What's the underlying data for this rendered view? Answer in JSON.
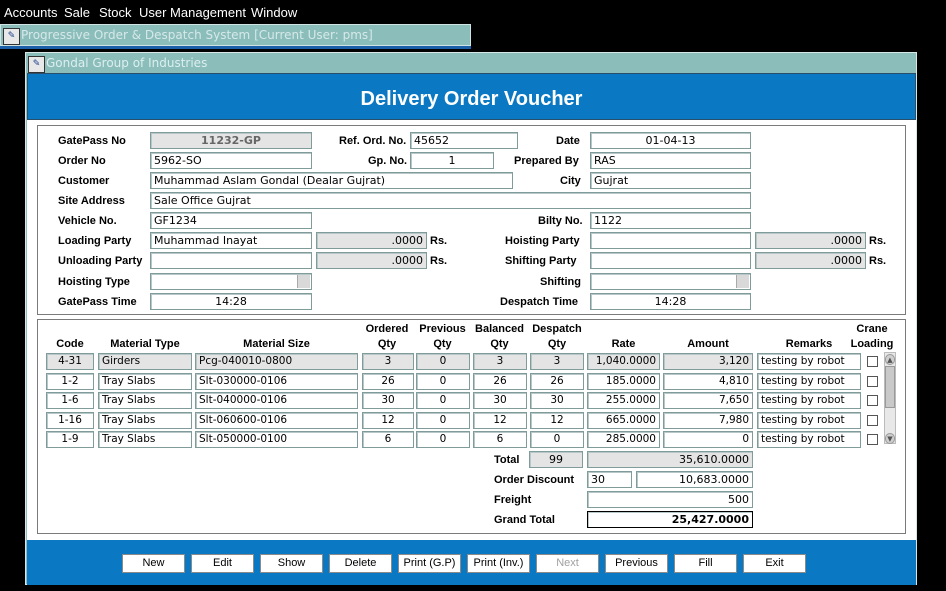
{
  "menu": [
    "Accounts",
    "Sale",
    "Stock",
    "User Management",
    "Window"
  ],
  "app_title": "Progressive Order & Despatch System     [Current User: pms]",
  "window_title": "Gondal Group of Industries",
  "form_title": "Delivery Order Voucher",
  "header": {
    "gatepass_no": {
      "label": "GatePass No",
      "value": "11232-GP"
    },
    "ref_ord_no": {
      "label": "Ref. Ord. No.",
      "value": "45652"
    },
    "date": {
      "label": "Date",
      "value": "01-04-13"
    },
    "order_no": {
      "label": "Order No",
      "value": "5962-SO"
    },
    "gp_no": {
      "label": "Gp. No.",
      "value": "1"
    },
    "prepared_by": {
      "label": "Prepared By",
      "value": "RAS"
    },
    "customer": {
      "label": "Customer",
      "value": "Muhammad Aslam Gondal  (Dealar Gujrat)"
    },
    "city": {
      "label": "City",
      "value": "Gujrat"
    },
    "site_address": {
      "label": "Site Address",
      "value": "Sale Office Gujrat"
    },
    "vehicle_no": {
      "label": "Vehicle No.",
      "value": "GF1234"
    },
    "bilty_no": {
      "label": "Bilty No.",
      "value": "1122"
    },
    "loading_party": {
      "label": "Loading Party",
      "value": "Muhammad Inayat",
      "amount": ".0000",
      "unit": "Rs."
    },
    "hoisting_party": {
      "label": "Hoisting Party",
      "value": "",
      "amount": ".0000",
      "unit": "Rs."
    },
    "unloading_party": {
      "label": "Unloading Party",
      "value": "",
      "amount": ".0000",
      "unit": "Rs."
    },
    "shifting_party": {
      "label": "Shifting Party",
      "value": "",
      "amount": ".0000",
      "unit": "Rs."
    },
    "hoisting_type": {
      "label": "Hoisting Type",
      "value": ""
    },
    "shifting": {
      "label": "Shifting",
      "value": ""
    },
    "gatepass_time": {
      "label": "GatePass Time",
      "value": "14:28"
    },
    "despatch_time": {
      "label": "Despatch Time",
      "value": "14:28"
    }
  },
  "columns": {
    "code": "Code",
    "material_type": "Material Type",
    "material_size": "Material Size",
    "ordered_1": "Ordered",
    "ordered_2": "Qty",
    "previous_1": "Previous",
    "previous_2": "Qty",
    "balanced_1": "Balanced",
    "balanced_2": "Qty",
    "despatch_1": "Despatch",
    "despatch_2": "Qty",
    "rate": "Rate",
    "amount": "Amount",
    "remarks": "Remarks",
    "crane_1": "Crane",
    "crane_2": "Loading"
  },
  "rows": [
    {
      "code": "4-31",
      "type": "Girders",
      "size": "Pcg-040010-0800",
      "ordered": "3",
      "previous": "0",
      "balanced": "3",
      "despatch": "3",
      "rate": "1,040.0000",
      "amount": "3,120",
      "remarks": "testing by robot",
      "crane": false
    },
    {
      "code": "1-2",
      "type": "Tray Slabs",
      "size": "Slt-030000-0106",
      "ordered": "26",
      "previous": "0",
      "balanced": "26",
      "despatch": "26",
      "rate": "185.0000",
      "amount": "4,810",
      "remarks": "testing by robot",
      "crane": false
    },
    {
      "code": "1-6",
      "type": "Tray Slabs",
      "size": "Slt-040000-0106",
      "ordered": "30",
      "previous": "0",
      "balanced": "30",
      "despatch": "30",
      "rate": "255.0000",
      "amount": "7,650",
      "remarks": "testing by robot",
      "crane": false
    },
    {
      "code": "1-16",
      "type": "Tray Slabs",
      "size": "Slt-060600-0106",
      "ordered": "12",
      "previous": "0",
      "balanced": "12",
      "despatch": "12",
      "rate": "665.0000",
      "amount": "7,980",
      "remarks": "testing by robot",
      "crane": false
    },
    {
      "code": "1-9",
      "type": "Tray Slabs",
      "size": "Slt-050000-0100",
      "ordered": "6",
      "previous": "0",
      "balanced": "6",
      "despatch": "0",
      "rate": "285.0000",
      "amount": "0",
      "remarks": "testing by robot",
      "crane": false
    }
  ],
  "totals": {
    "total_label": "Total",
    "total_qty": "99",
    "total_amount": "35,610.0000",
    "discount_label": "Order Discount",
    "discount_pct": "30",
    "discount_amount": "10,683.0000",
    "freight_label": "Freight",
    "freight": "500",
    "grand_total_label": "Grand Total",
    "grand_total": "25,427.0000"
  },
  "buttons": [
    "New",
    "Edit",
    "Show",
    "Delete",
    "Print (G.P)",
    "Print (Inv.)",
    "Next",
    "Previous",
    "Fill",
    "Exit"
  ],
  "colors": {
    "teal": "#8bbdbb",
    "blue": "#0a78c2",
    "disabled_text": "#a0a0a0"
  }
}
